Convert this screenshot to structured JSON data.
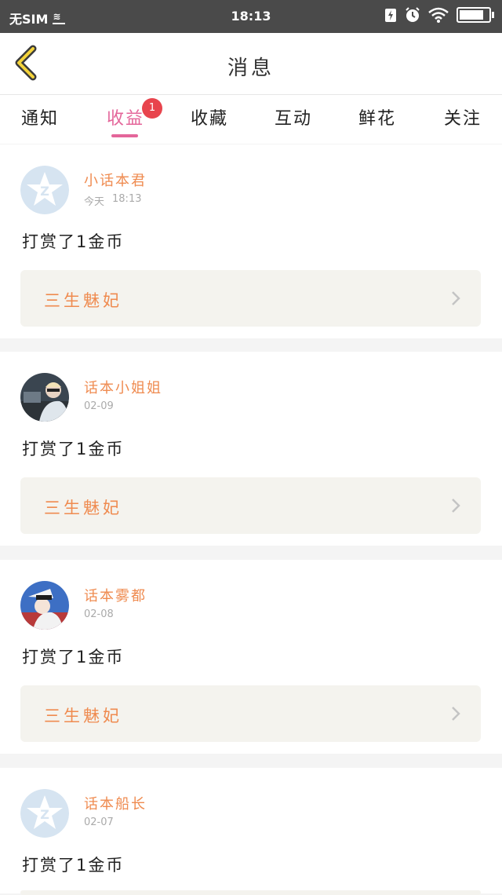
{
  "status_bar": {
    "carrier": "无SIM",
    "time": "18:13",
    "battery_level": 0.95
  },
  "header": {
    "title": "消息"
  },
  "tabs": [
    {
      "label": "通知"
    },
    {
      "label": "收益",
      "active": true,
      "badge": "1"
    },
    {
      "label": "收藏"
    },
    {
      "label": "互动"
    },
    {
      "label": "鲜花"
    },
    {
      "label": "关注"
    }
  ],
  "colors": {
    "accent_pink": "#e4669a",
    "name_orange": "#ef8b50",
    "badge_red": "#e8444d"
  },
  "messages": [
    {
      "name": "小话本君",
      "date": "今天",
      "time": "18:13",
      "text": "打赏了1金币",
      "book": "三生魅妃",
      "avatar": "default-qq-avatar"
    },
    {
      "name": "话本小姐姐",
      "date": "02-09",
      "text": "打赏了1金币",
      "book": "三生魅妃",
      "avatar": "photo-avatar"
    },
    {
      "name": "话本雾都",
      "date": "02-08",
      "text": "打赏了1金币",
      "book": "三生魅妃",
      "avatar": "anime-avatar"
    },
    {
      "name": "话本船长",
      "date": "02-07",
      "text": "打赏了1金币",
      "book": "",
      "avatar": "default-qq-avatar"
    }
  ]
}
